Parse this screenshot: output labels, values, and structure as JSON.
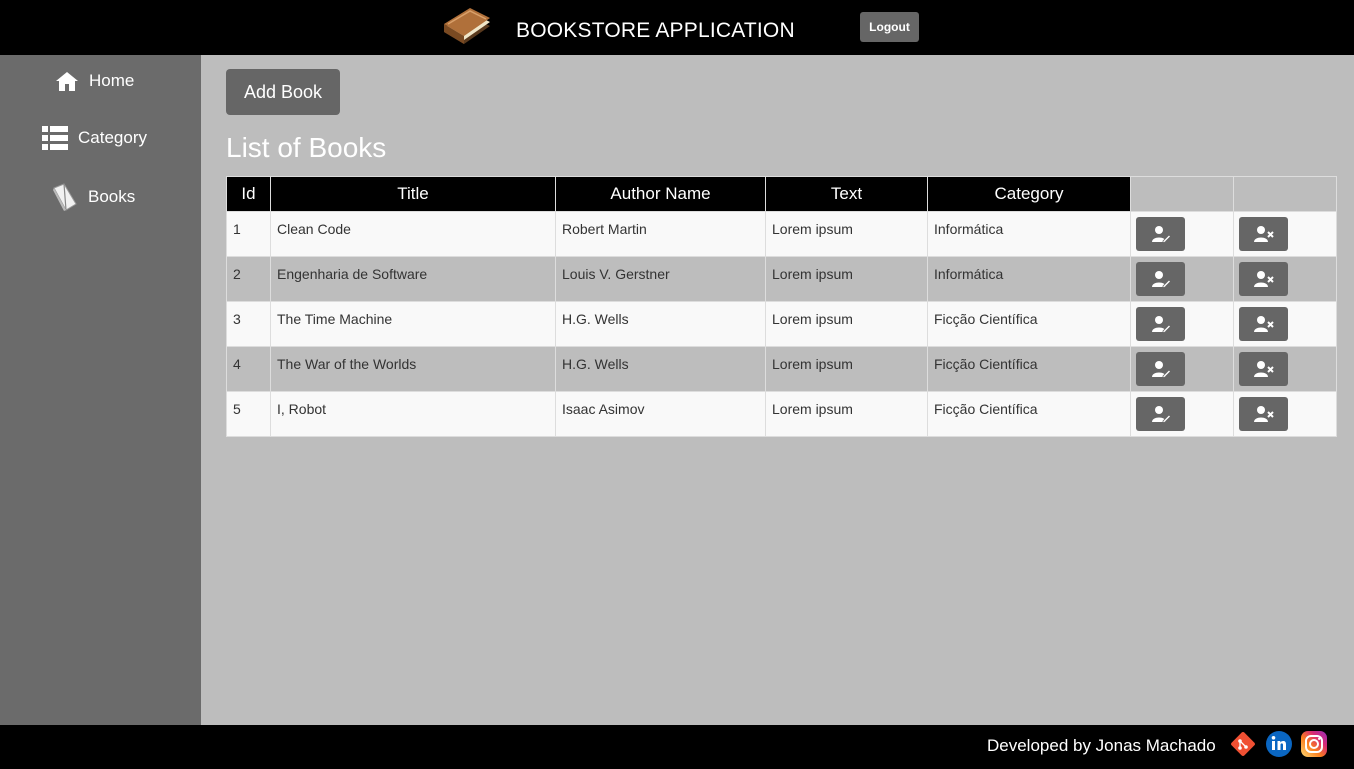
{
  "header": {
    "title": "BOOKSTORE APPLICATION",
    "logout_label": "Logout"
  },
  "sidebar": {
    "items": [
      {
        "label": "Home",
        "icon": "home-icon"
      },
      {
        "label": "Category",
        "icon": "list-icon"
      },
      {
        "label": "Books",
        "icon": "book-icon"
      }
    ]
  },
  "main": {
    "add_book_label": "Add Book",
    "page_title": "List of Books",
    "table": {
      "headers": [
        "Id",
        "Title",
        "Author Name",
        "Text",
        "Category"
      ],
      "rows": [
        {
          "id": "1",
          "title": "Clean Code",
          "author": "Robert Martin",
          "text": "Lorem ipsum",
          "category": "Informática"
        },
        {
          "id": "2",
          "title": "Engenharia de Software",
          "author": "Louis V. Gerstner",
          "text": "Lorem ipsum",
          "category": "Informática"
        },
        {
          "id": "3",
          "title": "The Time Machine",
          "author": "H.G. Wells",
          "text": "Lorem ipsum",
          "category": "Ficção Científica"
        },
        {
          "id": "4",
          "title": "The War of the Worlds",
          "author": "H.G. Wells",
          "text": "Lorem ipsum",
          "category": "Ficção Científica"
        },
        {
          "id": "5",
          "title": "I, Robot",
          "author": "Isaac Asimov",
          "text": "Lorem ipsum",
          "category": "Ficção Científica"
        }
      ]
    }
  },
  "footer": {
    "developed_by": "Developed by Jonas Machado",
    "social_icons": [
      "git-icon",
      "linkedin-icon",
      "instagram-icon"
    ]
  },
  "colors": {
    "header_bg": "#000000",
    "sidebar_bg": "#6b6b6b",
    "main_bg": "#bdbdbd",
    "button_bg": "#666666",
    "git": "#f05033",
    "linkedin": "#0a66c2"
  }
}
